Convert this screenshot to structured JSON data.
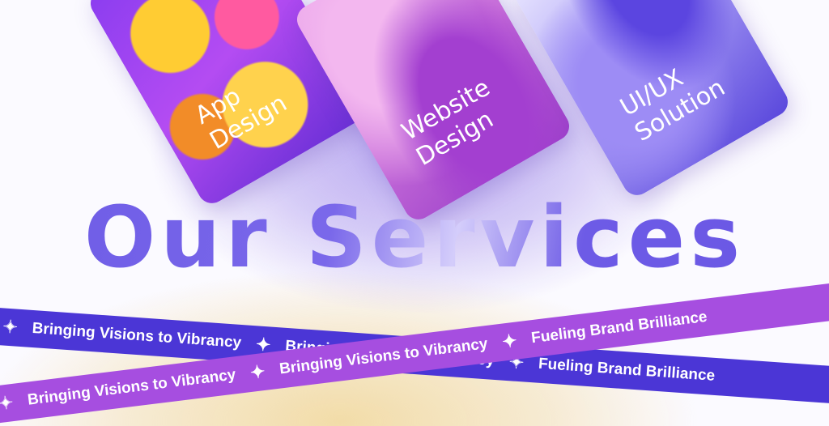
{
  "cards": [
    {
      "lines": [
        "App",
        "Design"
      ]
    },
    {
      "lines": [
        "Website",
        "Design"
      ]
    },
    {
      "lines": [
        "UI/UX",
        "Solution"
      ]
    }
  ],
  "title": "Our Services",
  "ribbon_blue": {
    "items": [
      "Bringing Visions to Vibrancy",
      "Bringing Visions to Vibrancy",
      "Fueling Brand Brilliance"
    ]
  },
  "ribbon_purple": {
    "items": [
      "Bringing Visions to Vibrancy",
      "Bringing Visions to Vibrancy",
      "Fueling Brand Brilliance"
    ]
  },
  "colors": {
    "accent_blue": "#4b36d6",
    "accent_purple": "#a64ee0",
    "title": "#6f5ee6"
  },
  "icons": {
    "separator": "sparkle-icon"
  }
}
